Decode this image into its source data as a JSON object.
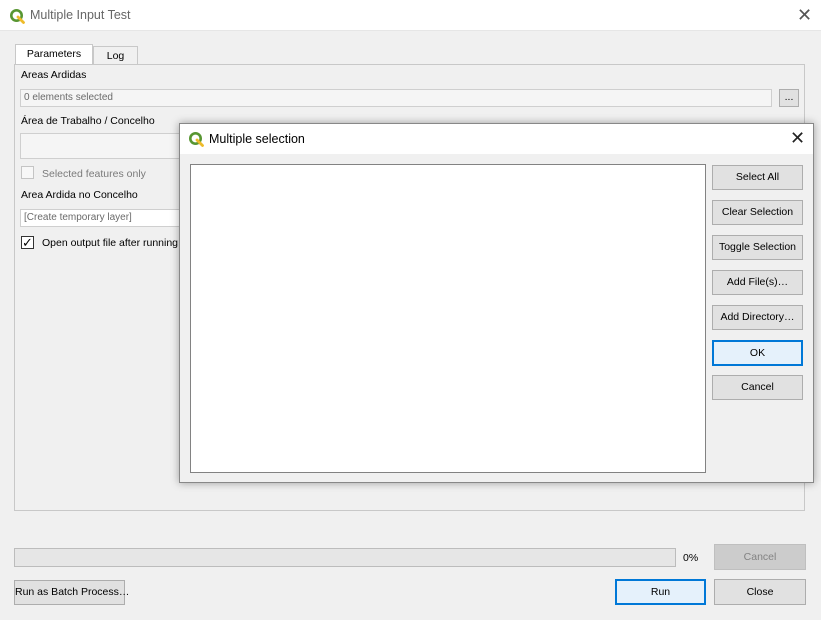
{
  "window": {
    "title": "Multiple Input Test",
    "icon": "qgis-icon",
    "close_glyph": "✕"
  },
  "tabs": [
    {
      "label": "Parameters",
      "active": true
    },
    {
      "label": "Log",
      "active": false
    }
  ],
  "params": {
    "areas_ardidas_label": "Areas Ardidas",
    "areas_ardidas_value": "0 elements selected",
    "browse_label": "...",
    "area_trabalho_label": "Área de Trabalho / Concelho",
    "selected_features_label": "Selected features only",
    "selected_features_checked": false,
    "area_ardida_label": "Area Ardida no Concelho",
    "area_ardida_placeholder": "[Create temporary layer]",
    "open_output_label": "Open output file after running",
    "open_output_checked": true,
    "check_glyph": "✓"
  },
  "progress": {
    "percent_label": "0%",
    "value": 0
  },
  "bottom_buttons": {
    "cancel": "Cancel",
    "batch": "Run as Batch Process…",
    "run": "Run",
    "close": "Close"
  },
  "dialog": {
    "title": "Multiple selection",
    "close_glyph": "✕",
    "items": [],
    "buttons": {
      "select_all": "Select All",
      "clear_selection": "Clear Selection",
      "toggle_selection": "Toggle Selection",
      "add_files": "Add File(s)…",
      "add_directory": "Add Directory…",
      "ok": "OK",
      "cancel": "Cancel"
    }
  },
  "colors": {
    "accent": "#0078d7",
    "qgis_green": "#589632",
    "qgis_yellow": "#eebb2a"
  }
}
